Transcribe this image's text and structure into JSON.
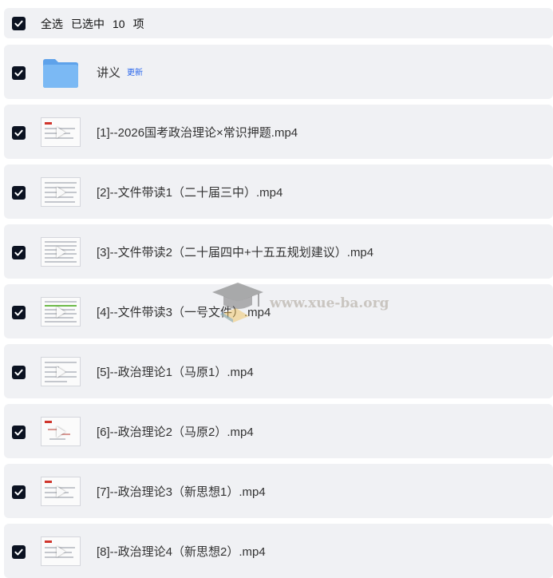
{
  "header": {
    "select_all": "全选",
    "selected_prefix": "已选中",
    "selected_count": "10",
    "selected_suffix": "项"
  },
  "items": [
    {
      "name": "讲义",
      "badge": "更新",
      "icon": "folder-icon"
    },
    {
      "name": "[1]--2026国考政治理论×常识押题.mp4",
      "icon": "video-thumbnail"
    },
    {
      "name": "[2]--文件带读1（二十届三中）.mp4",
      "icon": "video-thumbnail"
    },
    {
      "name": "[3]--文件带读2（二十届四中+十五五规划建议）.mp4",
      "icon": "video-thumbnail"
    },
    {
      "name": "[4]--文件带读3（一号文件）.mp4",
      "icon": "video-thumbnail"
    },
    {
      "name": "[5]--政治理论1（马原1）.mp4",
      "icon": "video-thumbnail"
    },
    {
      "name": "[6]--政治理论2（马原2）.mp4",
      "icon": "video-thumbnail"
    },
    {
      "name": "[7]--政治理论3（新思想1）.mp4",
      "icon": "video-thumbnail"
    },
    {
      "name": "[8]--政治理论4（新思想2）.mp4",
      "icon": "video-thumbnail"
    }
  ],
  "watermark": "www.xue-ba.org",
  "colors": {
    "row_bg": "#f0f1f4",
    "checkbox": "#0b1221",
    "badge": "#2563eb",
    "folder": "#6aaef0"
  }
}
